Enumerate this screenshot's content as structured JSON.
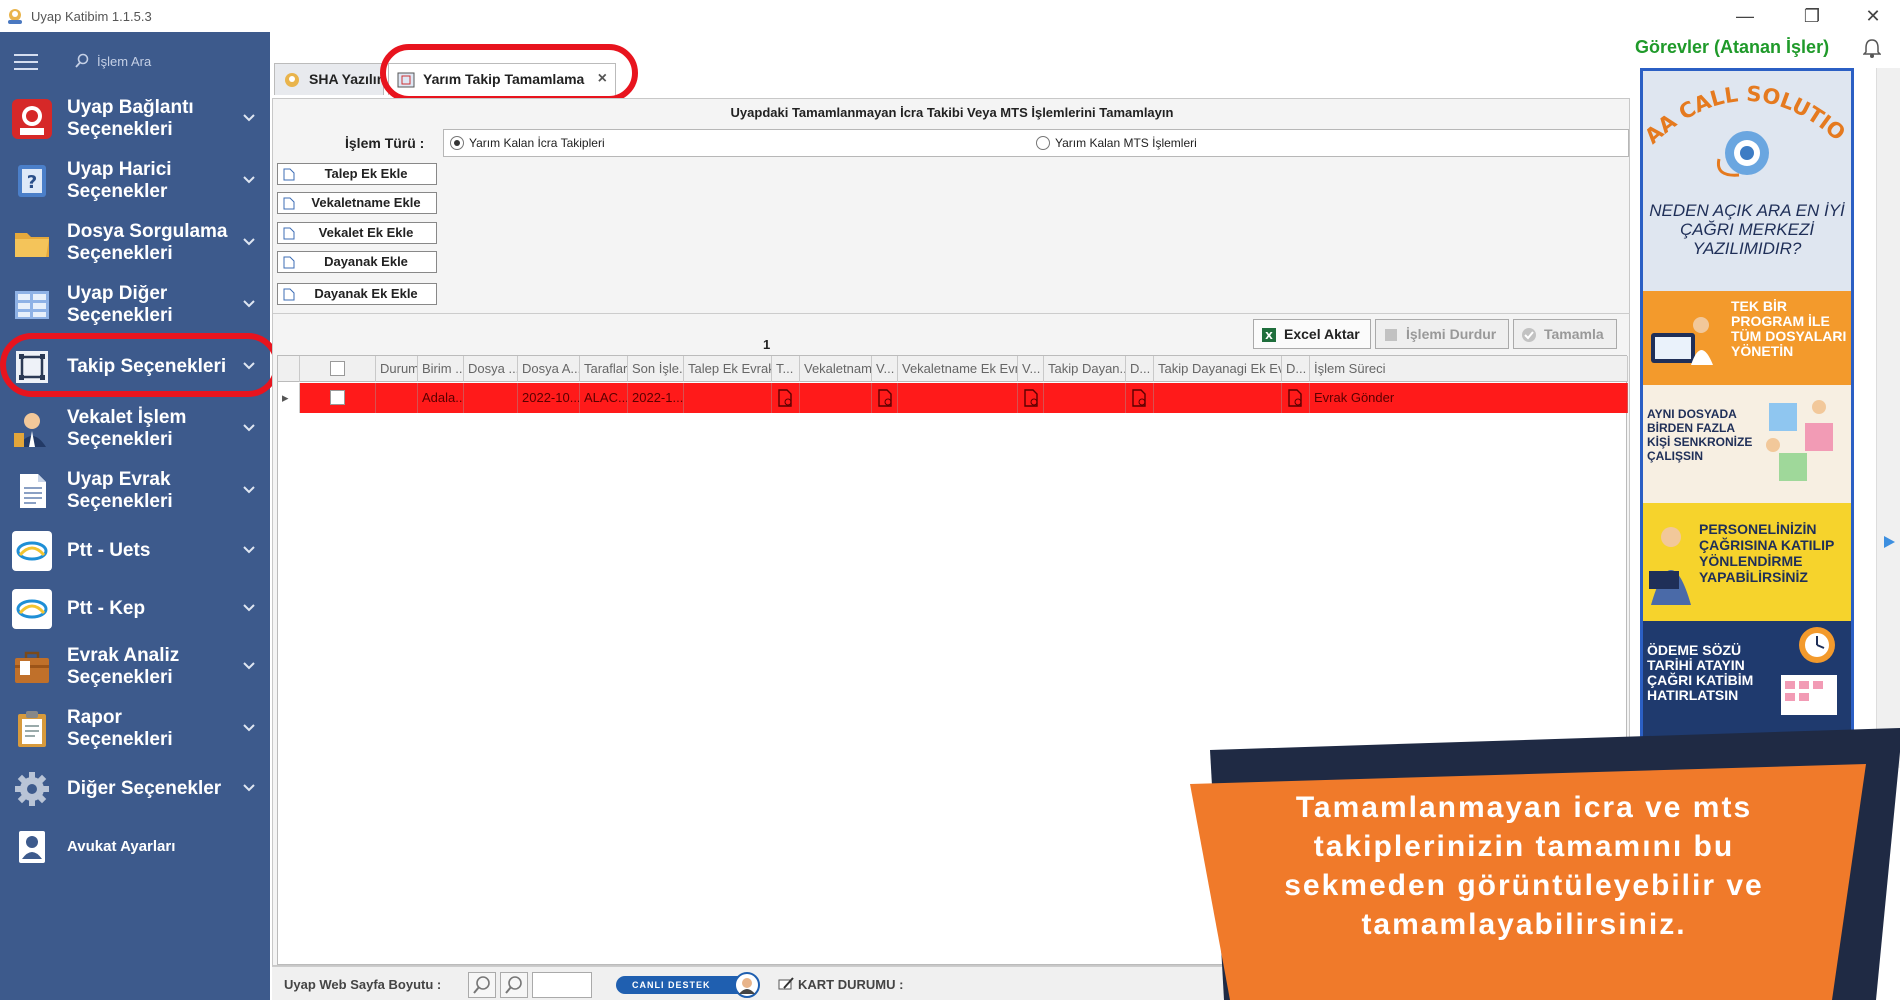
{
  "window": {
    "title": "Uyap Katibim 1.1.5.3",
    "buttons": {
      "minimize": "—",
      "restore": "❐",
      "close": "✕"
    }
  },
  "sidebar": {
    "search_label": "İşlem Ara",
    "items": [
      {
        "label": "Uyap Bağlantı\nSeçenekleri",
        "icon": "uyap-logo-icon"
      },
      {
        "label": "Uyap Harici\nSeçenekler",
        "icon": "question-book-icon"
      },
      {
        "label": "Dosya Sorgulama\nSeçenekleri",
        "icon": "folder-icon"
      },
      {
        "label": "Uyap Diğer\nSeçenekleri",
        "icon": "grid-icon"
      },
      {
        "label": "Takip Seçenekleri",
        "icon": "frame-icon"
      },
      {
        "label": "Vekalet İşlem\nSeçenekleri",
        "icon": "lawyer-icon"
      },
      {
        "label": "Uyap Evrak\nSeçenekleri",
        "icon": "document-icon"
      },
      {
        "label": "Ptt - Uets",
        "icon": "ptt-icon"
      },
      {
        "label": "Ptt - Kep",
        "icon": "ptt-icon"
      },
      {
        "label": "Evrak Analiz\nSeçenekleri",
        "icon": "briefcase-icon"
      },
      {
        "label": "Rapor\nSeçenekleri",
        "icon": "clipboard-icon"
      },
      {
        "label": "Diğer Seçenekler",
        "icon": "gear-icon"
      },
      {
        "label": "Avukat Ayarları",
        "icon": "user-card-icon"
      }
    ]
  },
  "tabs": [
    {
      "label": "SHA Yazılım"
    },
    {
      "label": "Yarım Takip Tamamlama",
      "close": "×",
      "active": true
    }
  ],
  "panel": {
    "title": "Uyapdaki Tamamlanmayan İcra Takibi Veya MTS İşlemlerini Tamamlayın",
    "islem_turu_label": "İşlem Türü :",
    "radio1": "Yarım Kalan İcra Takipleri",
    "radio2": "Yarım Kalan MTS İşlemleri",
    "side_buttons": [
      "Talep Ek Ekle",
      "Vekaletname Ekle",
      "Vekalet Ek Ekle",
      "Dayanak Ekle",
      "Dayanak Ek Ekle"
    ],
    "toolbar": {
      "excel": "Excel Aktar",
      "durdur": "İşlemi Durdur",
      "tamamla": "Tamamla"
    },
    "page_number": "1"
  },
  "grid": {
    "columns": [
      "Durum",
      "Birim ...",
      "Dosya ...",
      "Dosya A...",
      "Taraflar",
      "Son İşle...",
      "Talep Ek Evrak...",
      "T...",
      "Vekaletname",
      "V...",
      "Vekaletname Ek Evra...",
      "V...",
      "Takip Dayan...",
      "D...",
      "Takip Dayanagi Ek Evr...",
      "D...",
      "İşlem Süreci"
    ],
    "rows": [
      {
        "marker": "▸",
        "cells": [
          "",
          "Adala...",
          "",
          "2022-10...",
          "ALAC...",
          "2022-1...",
          "",
          "",
          "",
          "",
          "",
          "",
          "",
          "",
          "",
          "",
          "Evrak Gönder"
        ]
      }
    ]
  },
  "statusbar": {
    "page_size_label": "Uyap Web Sayfa Boyutu :",
    "canli_destek": "CANLI DESTEK",
    "kart_durumu": "KART DURUMU :"
  },
  "right": {
    "title": "Görevler (Atanan İşler)",
    "ad": {
      "brand": "TAA CALL SOLUTION",
      "headline": "NEDEN AÇIK ARA EN İYİ ÇAĞRI MERKEZİ YAZILIMIDIR?",
      "s1": "TEK BİR PROGRAM İLE TÜM DOSYALARI YÖNETİN",
      "s2": "AYNI DOSYADA BİRDEN FAZLA KİŞİ SENKRONİZE ÇALIŞSIN",
      "s3": "PERSONELİNİZİN ÇAĞRISINA KATILIP YÖNLENDİRME YAPABİLİRSİNİZ",
      "s4": "ÖDEME SÖZÜ TARİHİ ATAYIN ÇAĞRI KATİBİM HATIRLATSIN"
    }
  },
  "overlay_text": "Tamamlanmayan icra ve mts takiplerinizin tamamını bu sekmeden görüntüleyebilir ve tamamlayabilirsiniz.",
  "colors": {
    "sidebar": "#3d5a8c",
    "highlight": "#e8141e",
    "row": "#ff1a1a",
    "green": "#1f9a2a",
    "orange": "#f07a2a",
    "navy": "#1f2a44"
  }
}
